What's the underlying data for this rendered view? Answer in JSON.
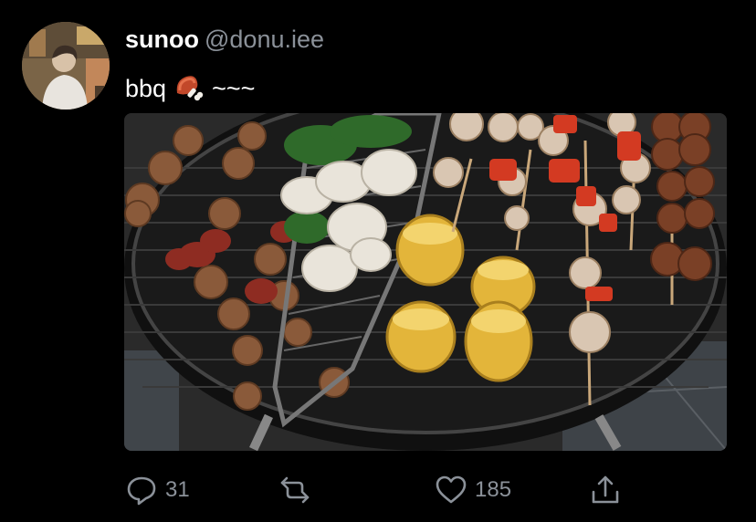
{
  "tweet": {
    "display_name": "sunoo",
    "handle": "@donu.iee",
    "text_before_emoji": "bbq",
    "emoji_icon": "meat-on-bone-emoji",
    "text_after_emoji": "~~~",
    "media_description_icon": "bbq-grill-photo"
  },
  "actions": {
    "reply_count": "31",
    "retweet_count": "",
    "like_count": "185",
    "share_icon": "share-icon"
  },
  "colors": {
    "background": "#000000",
    "text_primary": "#ffffff",
    "text_secondary": "#8b9199"
  }
}
